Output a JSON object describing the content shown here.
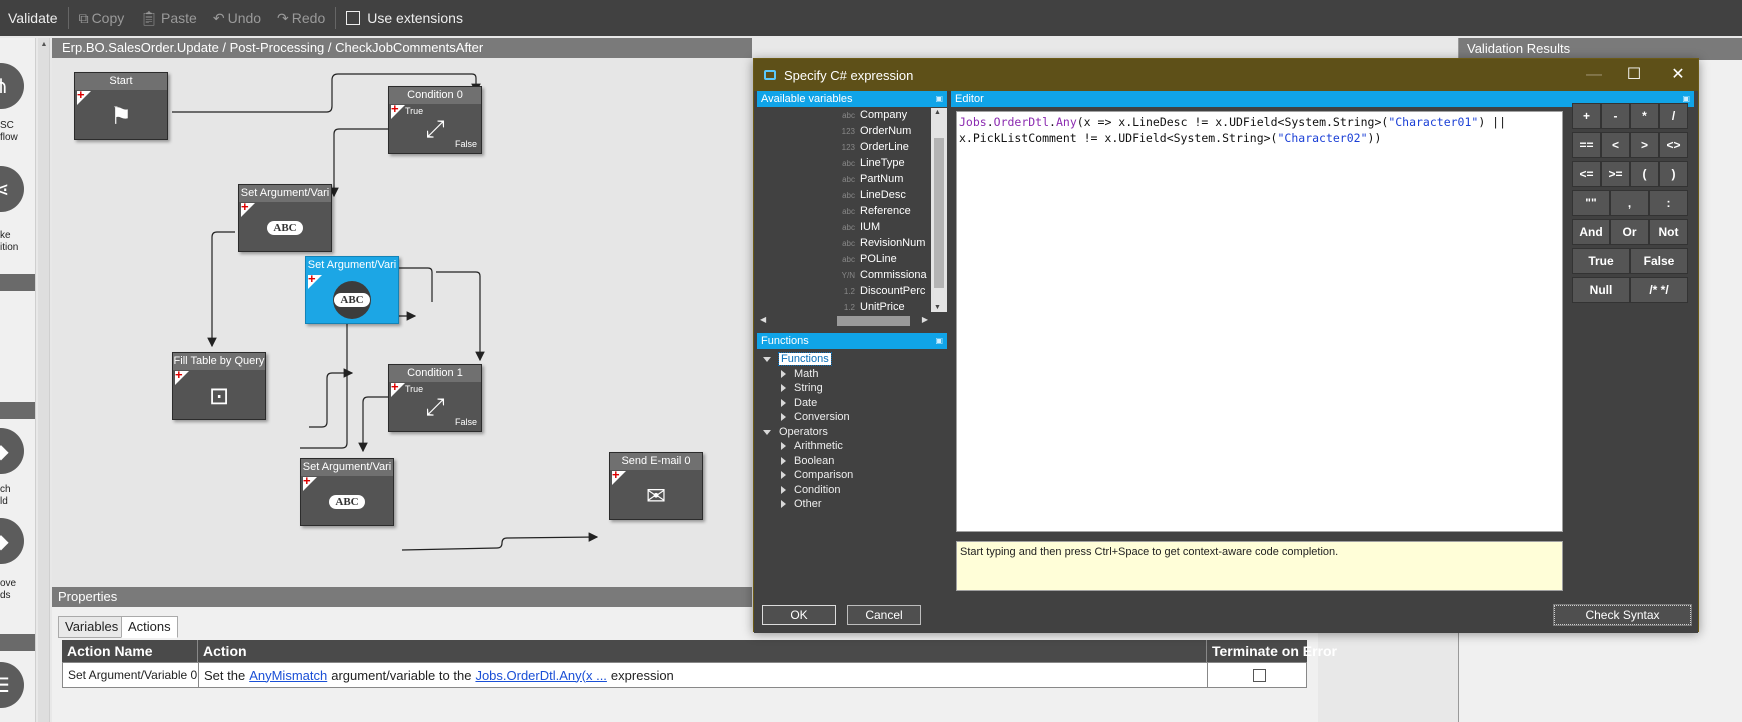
{
  "toolbar": {
    "validate": "Validate",
    "copy": "Copy",
    "paste": "Paste",
    "undo": "Undo",
    "redo": "Redo",
    "use_extensions": "Use extensions"
  },
  "palette": {
    "item1": "SC\nflow",
    "item2": "ke\nition",
    "item3": "ch\nld",
    "item4": "ove\nds"
  },
  "breadcrumb": "Erp.BO.SalesOrder.Update / Post-Processing / CheckJobCommentsAfter",
  "nodes": {
    "start": "Start",
    "condition0": "Condition 0",
    "set_arg1": "Set Argument/Vari",
    "set_arg2": "Set Argument/Vari",
    "fill_table": "Fill Table by Query",
    "condition1": "Condition 1",
    "set_arg3": "Set Argument/Vari",
    "send_email": "Send E-mail 0",
    "true_label": "True",
    "false_label": "False",
    "abc": "ABC"
  },
  "properties": {
    "header": "Properties",
    "tabs": [
      "Variables",
      "Actions"
    ],
    "columns": [
      "Action Name",
      "Action",
      "Terminate on Error"
    ],
    "row": {
      "action_name": "Set Argument/Variable 0",
      "action_prefix": "Set the",
      "action_link1": "AnyMismatch",
      "action_middle": "argument/variable to the",
      "action_link2": "Jobs.OrderDtl.Any(x ...",
      "action_suffix": "expression"
    }
  },
  "validation": {
    "header": "Validation Results"
  },
  "dialog": {
    "title": "Specify C# expression",
    "available_variables": "Available variables",
    "editor": "Editor",
    "functions_header": "Functions",
    "variables": [
      {
        "type": "abc",
        "name": "Company"
      },
      {
        "type": "123",
        "name": "OrderNum"
      },
      {
        "type": "123",
        "name": "OrderLine"
      },
      {
        "type": "abc",
        "name": "LineType"
      },
      {
        "type": "abc",
        "name": "PartNum"
      },
      {
        "type": "abc",
        "name": "LineDesc"
      },
      {
        "type": "abc",
        "name": "Reference"
      },
      {
        "type": "abc",
        "name": "IUM"
      },
      {
        "type": "abc",
        "name": "RevisionNum"
      },
      {
        "type": "abc",
        "name": "POLine"
      },
      {
        "type": "Y/N",
        "name": "Commissiona"
      },
      {
        "type": "1.2",
        "name": "DiscountPerc"
      },
      {
        "type": "1.2",
        "name": "UnitPrice"
      }
    ],
    "tree": {
      "functions": "Functions",
      "math": "Math",
      "string": "String",
      "date": "Date",
      "conversion": "Conversion",
      "operators": "Operators",
      "arithmetic": "Arithmetic",
      "boolean": "Boolean",
      "comparison": "Comparison",
      "condition": "Condition",
      "other": "Other"
    },
    "code": {
      "part1": "Jobs",
      "part2": ".",
      "part3": "OrderDtl",
      "part4": ".",
      "part5": "Any",
      "part6": "(x => x.LineDesc != x.UDField<System.String>(",
      "part7": "\"Character01\"",
      "part8": ") ||",
      "part9": "x.PickListComment != x.UDField<System.String>(",
      "part10": "\"Character02\"",
      "part11": "))"
    },
    "hint": "Start typing and then press Ctrl+Space to get context-aware code completion.",
    "operators": [
      "+",
      "-",
      "*",
      "/",
      "==",
      "<",
      ">",
      "<>",
      "<=",
      ">=",
      "(",
      ")",
      "\"\"",
      ",",
      ":",
      "And",
      "Or",
      "Not",
      "True",
      "False",
      "Null",
      "/* */"
    ],
    "ok": "OK",
    "cancel": "Cancel",
    "check_syntax": "Check Syntax"
  }
}
